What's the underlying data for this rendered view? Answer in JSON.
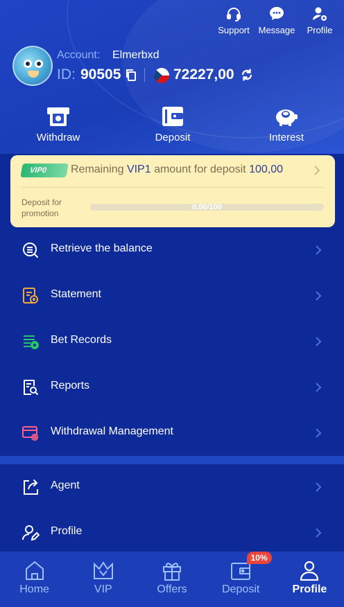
{
  "header": {
    "actions": [
      {
        "label": "Support",
        "icon": "headset-icon"
      },
      {
        "label": "Message",
        "icon": "chat-bubble-icon"
      },
      {
        "label": "Profile",
        "icon": "user-settings-icon"
      }
    ],
    "account_label": "Account:",
    "account_name": "Elmerbxd",
    "id_label": "ID:",
    "id_value": "90505",
    "balance": "72227,00",
    "currency_flag": "czech-flag"
  },
  "quick_actions": [
    {
      "label": "Withdraw",
      "icon": "withdraw-icon"
    },
    {
      "label": "Deposit",
      "icon": "wallet-icon"
    },
    {
      "label": "Interest",
      "icon": "piggy-bank-icon"
    }
  ],
  "vip": {
    "badge": "VIP0",
    "text_before": "Remaining",
    "level": "VIP1",
    "text_middle": "amount for deposit",
    "amount": "100,00",
    "sub_label": "Deposit for promotion",
    "progress_text": "0.00/100",
    "progress_fraction": 0
  },
  "menu": [
    {
      "label": "Retrieve the balance",
      "icon": "coins-search-icon",
      "color": "#ffffff"
    },
    {
      "label": "Statement",
      "icon": "statement-icon",
      "color": "#f0a93a"
    },
    {
      "label": "Bet Records",
      "icon": "bet-records-icon",
      "color": "#27c46b"
    },
    {
      "label": "Reports",
      "icon": "report-search-icon",
      "color": "#ffffff"
    },
    {
      "label": "Withdrawal Management",
      "icon": "card-settings-icon",
      "color": "#ff5f8c"
    }
  ],
  "menu2": [
    {
      "label": "Agent",
      "icon": "share-icon"
    },
    {
      "label": "Profile",
      "icon": "user-edit-icon"
    }
  ],
  "bottom_nav": [
    {
      "label": "Home",
      "icon": "home-icon"
    },
    {
      "label": "VIP",
      "icon": "crown-icon"
    },
    {
      "label": "Offers",
      "icon": "gift-icon"
    },
    {
      "label": "Deposit",
      "icon": "wallet-icon",
      "badge": "10%"
    },
    {
      "label": "Profile",
      "icon": "user-icon",
      "active": true
    }
  ]
}
